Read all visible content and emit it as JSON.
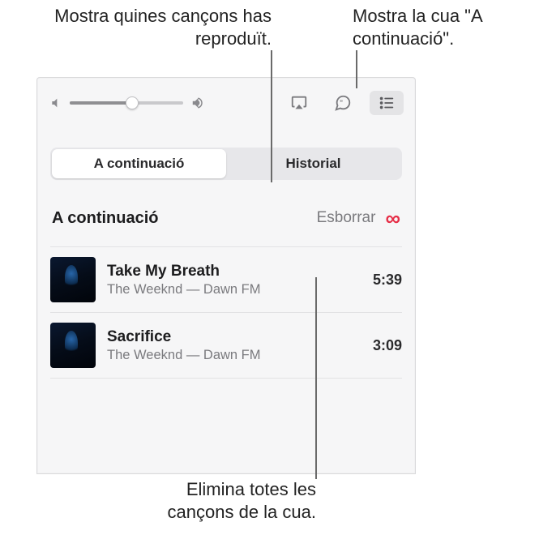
{
  "callouts": {
    "history": "Mostra quines cançons has reproduït.",
    "queueButton": "Mostra la cua \"A continuació\".",
    "clear": "Elimina totes les cançons de la cua."
  },
  "toolbar": {
    "volume_percent": 55
  },
  "segmented": {
    "upnext": "A continuació",
    "history": "Historial"
  },
  "section": {
    "title": "A continuació",
    "clear": "Esborrar"
  },
  "tracks": [
    {
      "title": "Take My Breath",
      "subtitle": "The Weeknd — Dawn FM",
      "duration": "5:39"
    },
    {
      "title": "Sacrifice",
      "subtitle": "The Weeknd — Dawn FM",
      "duration": "3:09"
    }
  ]
}
